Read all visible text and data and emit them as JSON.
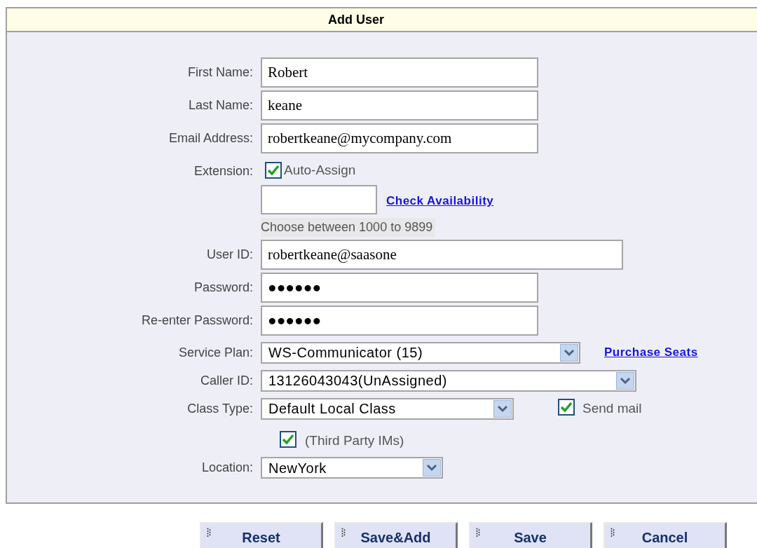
{
  "title": "Add User",
  "fields": [
    {
      "kind": "text",
      "label": "First Name:",
      "value": "Robert"
    },
    {
      "kind": "text",
      "label": "Last Name:",
      "value": "keane"
    },
    {
      "kind": "text",
      "label": "Email Address:",
      "value": "robertkeane@mycompany.com"
    },
    {
      "kind": "extension",
      "label": "Extension:",
      "checkbox": {
        "label": "Auto-Assign",
        "checked": true
      },
      "link": "Check Availability",
      "hint": "Choose between 1000 to 9899"
    },
    {
      "kind": "text",
      "label": "User ID:",
      "value": "robertkeane@saasone"
    },
    {
      "kind": "text",
      "label": "Password:",
      "value": "●●●●●●"
    },
    {
      "kind": "text",
      "label": "Re-enter Password:",
      "value": "●●●●●●"
    },
    {
      "kind": "select",
      "label": "Service Plan:",
      "value": "WS-Communicator (15)",
      "link": "Purchase Seats"
    },
    {
      "kind": "select",
      "label": "Caller ID:",
      "value": "13126043043(UnAssigned)"
    },
    {
      "kind": "select",
      "label": "Class Type:",
      "value": "Default Local Class",
      "checkbox": {
        "label": "Send mail",
        "checked": true
      }
    },
    {
      "kind": "checkbox",
      "label": "(Third Party IMs)",
      "checked": true
    },
    {
      "kind": "select",
      "label": "Location:",
      "value": "NewYork"
    }
  ],
  "buttons": [
    "Reset",
    "Save&Add",
    "Save",
    "Cancel"
  ]
}
